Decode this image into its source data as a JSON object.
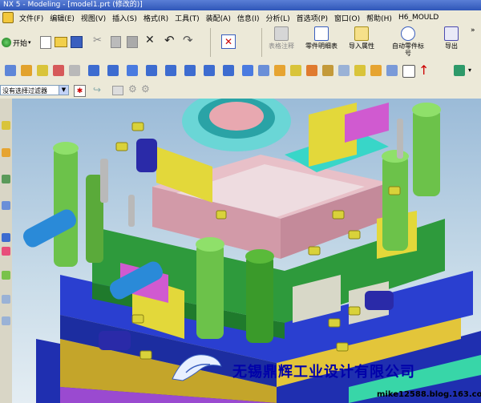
{
  "window": {
    "title": "NX 5 - Modeling - [model1.prt (修改的)]"
  },
  "menu": {
    "items": [
      "文件(F)",
      "编辑(E)",
      "视图(V)",
      "插入(S)",
      "格式(R)",
      "工具(T)",
      "装配(A)",
      "信息(I)",
      "分析(L)",
      "首选项(P)",
      "窗口(O)",
      "帮助(H)",
      "H6_MOULD"
    ]
  },
  "toolbar": {
    "start_label": "开始",
    "table_note": "表格注释",
    "part_list": "零件明细表",
    "import_attr": "导入属性",
    "auto_balloon": "自动零件标号",
    "export": "导出"
  },
  "filter": {
    "value": "没有选择过滤器"
  },
  "watermark": {
    "company": "无锡鼎辉工业设计有限公司",
    "blog": "mike12588.blog.163.com"
  },
  "colors": {
    "menu_bg": "#ece9d8",
    "title_bg": "#2f56b8",
    "viewport_top": "#9bbbd8",
    "watermark": "#0000aa"
  }
}
